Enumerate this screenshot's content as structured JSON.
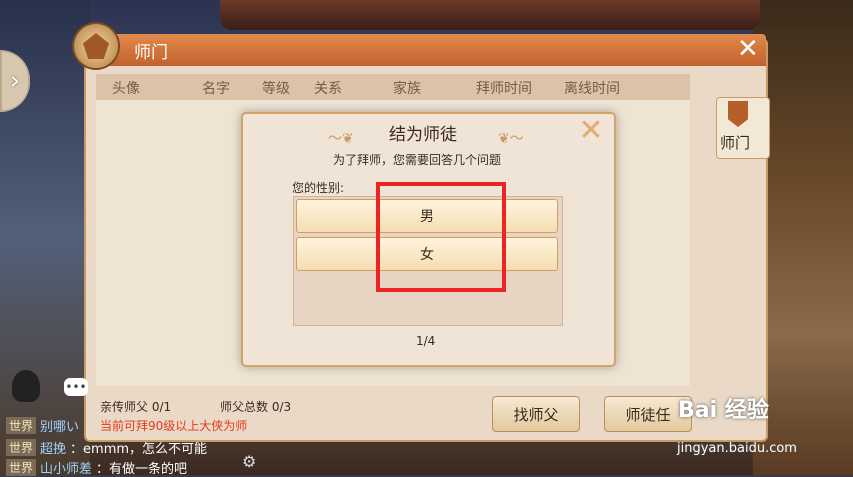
{
  "panel": {
    "title": "师门",
    "close": "✕",
    "columns": [
      "头像",
      "名字",
      "等级",
      "关系",
      "家族",
      "拜师时间",
      "离线时间"
    ],
    "tab": "师门",
    "footer_direct": "亲传师父  0/1",
    "footer_total": "师父总数  0/3",
    "footer_note": "当前可拜90级以上大侠为师",
    "btn_find": "找师父",
    "btn_more": "师徒任"
  },
  "dialog": {
    "title": "结为师徒",
    "subtitle": "为了拜师，您需要回答几个问题",
    "question": "您的性别:",
    "options": [
      "男",
      "女"
    ],
    "page": "1/4",
    "close": "✕"
  },
  "chat": [
    {
      "channel": "世界",
      "name": "别哪い",
      "msg": ""
    },
    {
      "channel": "世界",
      "name": "超挽",
      "msg": "：emmm，怎么不可能"
    },
    {
      "channel": "世界",
      "name": "山小师差",
      "msg": "：有做一条的吧"
    }
  ],
  "side_arrow": "›",
  "watermark": {
    "brand": "Bai 经验",
    "url": "jingyan.baidu.com"
  },
  "highlight_color": "#ec2424"
}
